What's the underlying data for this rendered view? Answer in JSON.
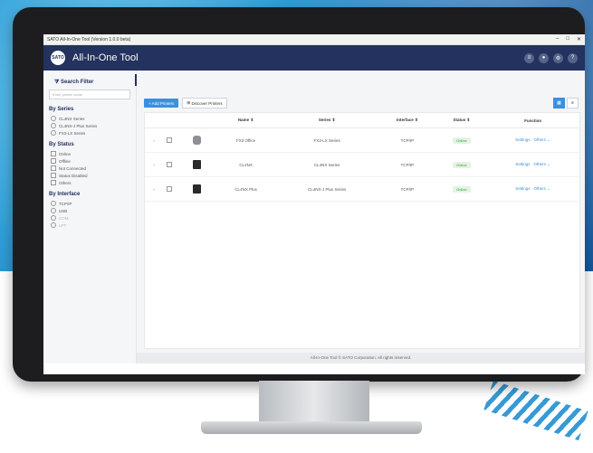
{
  "window": {
    "title": "SATO All-In-One Tool (Version 1.0.0 beta)",
    "controls": [
      "–",
      "□",
      "✕"
    ]
  },
  "app": {
    "name": "All-In-One Tool",
    "logo_text": "SATO"
  },
  "sidebar": {
    "filter_title": "Search Filter",
    "search_placeholder": "Enter printer name",
    "by_series": {
      "title": "By Series",
      "items": [
        "CL4NX Series",
        "CL4NX-J Plus Series",
        "FX3-LX Series"
      ]
    },
    "by_status": {
      "title": "By Status",
      "items": [
        "Online",
        "Offline",
        "Not Connected",
        "Status Disabled",
        "Others"
      ]
    },
    "by_interface": {
      "title": "By Interface",
      "items": [
        "TCP/IP",
        "USB",
        "COM",
        "LPT"
      ]
    }
  },
  "toolbar": {
    "add_printers": "+ Add Printers",
    "discover_printers": "Discover Printers"
  },
  "table": {
    "headers": [
      "Name",
      "Series",
      "Interface",
      "Status",
      "Function"
    ],
    "rows": [
      {
        "name": "FX3 Office",
        "series": "FX3-LX Series",
        "interface": "TCP/IP",
        "status": "Online",
        "settings": "Settings",
        "others": "Others"
      },
      {
        "name": "CL4NX",
        "series": "CL4NX Series",
        "interface": "TCP/IP",
        "status": "Online",
        "settings": "Settings",
        "others": "Others"
      },
      {
        "name": "CL4NX Plus",
        "series": "CL4NX-J Plus Series",
        "interface": "TCP/IP",
        "status": "Online",
        "settings": "Settings",
        "others": "Others"
      }
    ]
  },
  "footer": {
    "text": "All-In-One Tool © SATO Corporation. All rights reserved."
  },
  "colors": {
    "header": "#23325e",
    "primary": "#3b8fe0",
    "status_online": "#3b9c3b"
  }
}
